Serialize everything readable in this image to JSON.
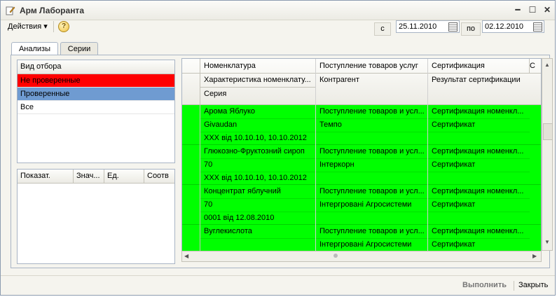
{
  "window": {
    "title": "Арм Лаборанта"
  },
  "toolbar": {
    "actions_label": "Действия",
    "help_glyph": "?",
    "from_label": "с",
    "from_date": "25.11.2010",
    "to_label": "по",
    "to_date": "02.12.2010"
  },
  "tabs": [
    {
      "label": "Анализы",
      "active": true
    },
    {
      "label": "Серии",
      "active": false
    }
  ],
  "filter": {
    "header": "Вид отбора",
    "items": [
      {
        "label": "Не проверенные",
        "color": "#ff0000"
      },
      {
        "label": "Проверенные",
        "color": "#6f9bd1"
      },
      {
        "label": "Все",
        "color": "#ffffff"
      }
    ]
  },
  "indicators": {
    "columns": [
      "Показат.",
      "Знач...",
      "Ед.",
      "Соотв"
    ]
  },
  "grid": {
    "header_row1": [
      "Номенклатура",
      "Поступление товаров услуг",
      "Сертификация",
      "С"
    ],
    "header_row2": [
      "Характеристика номенклату...",
      "Контрагент",
      "Результат сертификации"
    ],
    "header_row3": [
      "Серия"
    ],
    "rows": [
      {
        "name": "Арома Яблуко",
        "characteristic": "Givaudan",
        "series": "XXX від 10.10.10, 10.10.2012",
        "receipt": "Поступление товаров и усл...",
        "contractor": "Темпо",
        "certification": "Сертификация номенкл...",
        "result": "Сертификат"
      },
      {
        "name": "Глюкозно-Фруктозний сироп",
        "characteristic": "70",
        "series": "XXX від 10.10.10, 10.10.2012",
        "receipt": "Поступление товаров и усл...",
        "contractor": "Інтеркорн",
        "certification": "Сертификация номенкл...",
        "result": "Сертификат"
      },
      {
        "name": "Концентрат яблучний",
        "characteristic": "70",
        "series": "0001 від 12.08.2010",
        "receipt": "Поступление товаров и усл...",
        "contractor": "Інтергровані Агросистеми",
        "certification": "Сертификация номенкл...",
        "result": "Сертификат"
      },
      {
        "name": "Вуглекислота",
        "characteristic": "",
        "series": "",
        "receipt": "Поступление товаров и усл...",
        "contractor": "Інтергровані Агросистеми",
        "certification": "Сертификация номенкл...",
        "result": "Сертификат"
      }
    ],
    "row_color": "#00ff00"
  },
  "footer": {
    "execute_label": "Выполнить",
    "close_label": "Закрыть"
  }
}
